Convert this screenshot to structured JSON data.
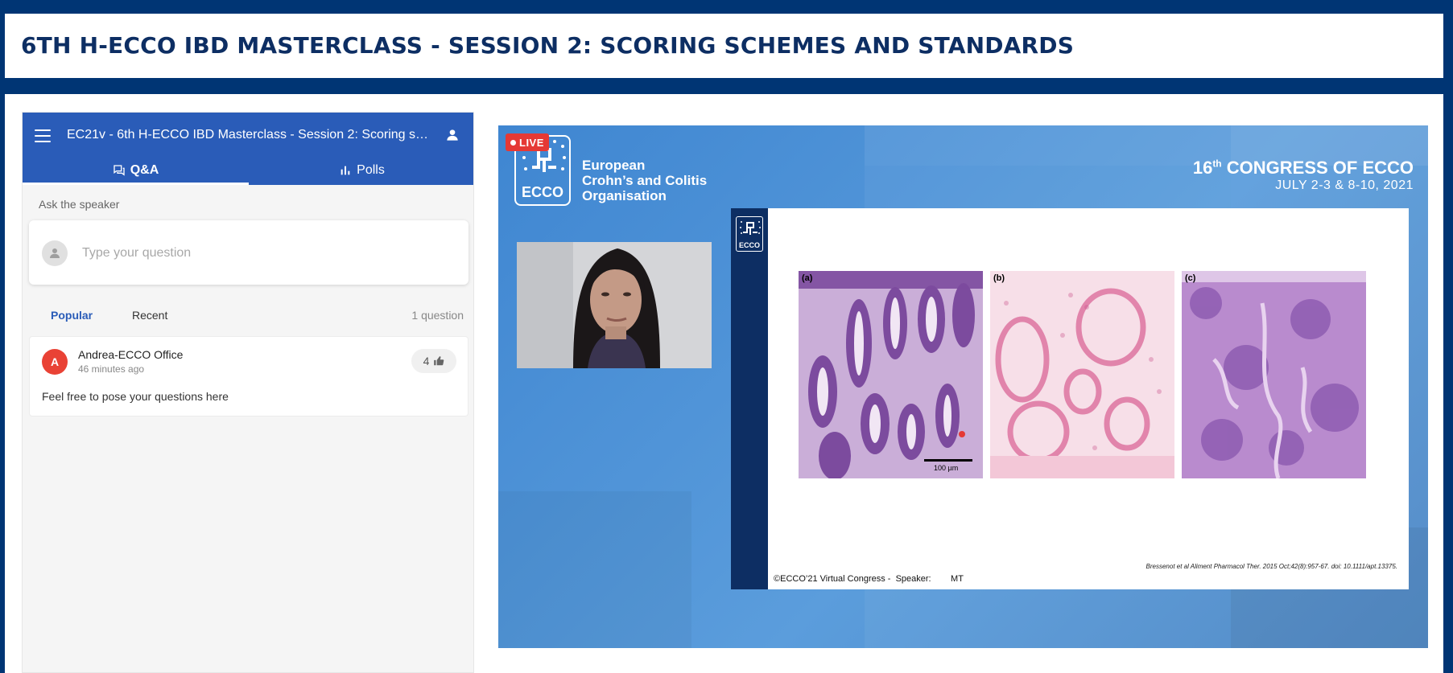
{
  "page": {
    "title": "6TH H-ECCO IBD MASTERCLASS - SESSION 2: SCORING SCHEMES AND STANDARDS"
  },
  "slido": {
    "event_title": "EC21v - 6th H-ECCO IBD Masterclass - Session 2: Scoring schemes and standards",
    "tabs": [
      {
        "label": "Q&A",
        "icon": "qa-icon",
        "active": true
      },
      {
        "label": "Polls",
        "icon": "polls-icon",
        "active": false
      }
    ],
    "ask_label": "Ask the speaker",
    "ask_placeholder": "Type your question",
    "sort": {
      "popular": "Popular",
      "recent": "Recent",
      "count": "1 question"
    },
    "questions": [
      {
        "avatar_letter": "A",
        "author": "Andrea-ECCO Office",
        "time": "46 minutes ago",
        "likes": "4",
        "text": "Feel free to pose your questions here"
      }
    ],
    "colors": {
      "header": "#2a5cb8",
      "avatar": "#e94235"
    }
  },
  "video": {
    "live_label": "LIVE",
    "logo_text": "ECCO",
    "org_lines": [
      "European",
      "Crohn’s and Colitis",
      "Organisation"
    ],
    "congress_num": "16",
    "congress_sup": "th",
    "congress_rest": " CONGRESS OF ECCO",
    "congress_dates": "JULY 2-3 & 8-10, 2021",
    "slide": {
      "logo_text": "ECCO",
      "panels": [
        "(a)",
        "(b)",
        "(c)"
      ],
      "scale_label": "100 µm",
      "citation": "Bressenot et al Aliment Pharmacol Ther. 2015 Oct;42(8):957-67. doi: 10.1111/apt.13375.",
      "footer": "©ECCO’21 Virtual Congress -  Speaker:        MT"
    }
  }
}
